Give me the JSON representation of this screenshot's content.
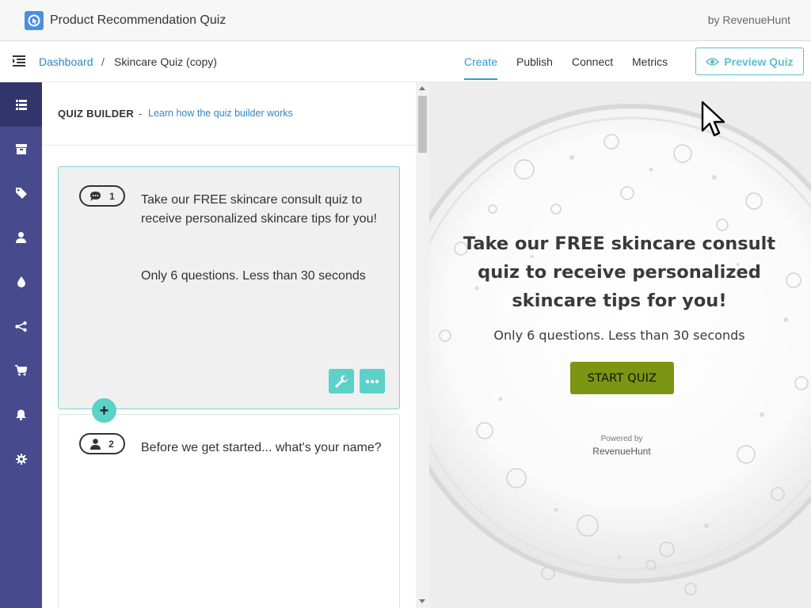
{
  "app": {
    "title": "Product Recommendation Quiz",
    "by": "by RevenueHunt"
  },
  "breadcrumb": {
    "root": "Dashboard",
    "separator": "/",
    "current": "Skincare Quiz (copy)"
  },
  "nav": {
    "tabs": [
      {
        "label": "Create",
        "active": true
      },
      {
        "label": "Publish",
        "active": false
      },
      {
        "label": "Connect",
        "active": false
      },
      {
        "label": "Metrics",
        "active": false
      }
    ],
    "preview_label": "Preview Quiz"
  },
  "sidebar": {
    "items": [
      {
        "icon": "list-icon",
        "active": true
      },
      {
        "icon": "box-icon",
        "active": false
      },
      {
        "icon": "tag-icon",
        "active": false
      },
      {
        "icon": "user-icon",
        "active": false
      },
      {
        "icon": "drop-icon",
        "active": false
      },
      {
        "icon": "branch-icon",
        "active": false
      },
      {
        "icon": "cart-icon",
        "active": false
      },
      {
        "icon": "bell-icon",
        "active": false
      },
      {
        "icon": "gear-icon",
        "active": false
      }
    ]
  },
  "builder": {
    "title": "QUIZ BUILDER",
    "dash": "-",
    "help_link": "Learn how the quiz builder works",
    "cards": [
      {
        "number": "1",
        "icon": "chat-icon",
        "text": "Take our FREE skincare consult quiz to receive personalized skincare tips for you!",
        "subtext": "Only 6 questions. Less than 30 seconds"
      },
      {
        "number": "2",
        "icon": "person-icon",
        "text": "Before we get started... what's your name?"
      }
    ],
    "add_label": "+"
  },
  "preview": {
    "title": "Take our FREE skincare consult quiz to receive personalized skincare tips for you!",
    "subtitle": "Only 6 questions. Less than 30 seconds",
    "start_label": "START QUIZ",
    "powered_by": "Powered by",
    "brand": "RevenueHunt"
  },
  "colors": {
    "sidebar": "#474b8d",
    "accent": "#5bd1c8",
    "link": "#2e86c9",
    "start_button": "#7c9512"
  }
}
